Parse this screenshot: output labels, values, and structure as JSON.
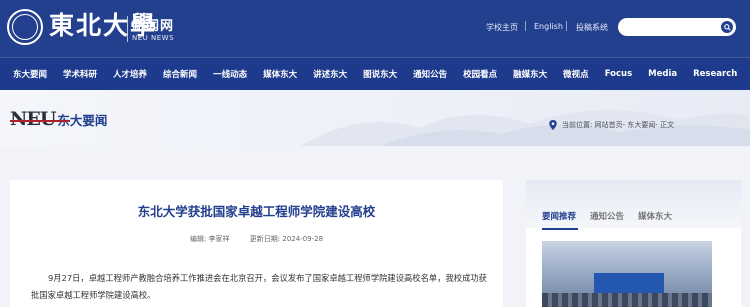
{
  "header": {
    "logo_calligraphy": "東北大學",
    "logo_news_cn": "新闻网",
    "logo_news_en": "NEU NEWS",
    "links": [
      "学校主页",
      "English",
      "投稿系统"
    ],
    "search_placeholder": ""
  },
  "nav": {
    "items": [
      "东大要闻",
      "学术科研",
      "人才培养",
      "综合新闻",
      "一线动态",
      "媒体东大",
      "讲述东大",
      "图说东大",
      "通知公告",
      "校园看点",
      "融媒东大",
      "微视点",
      "Focus",
      "Media",
      "Research"
    ]
  },
  "banner": {
    "neu": "NEU",
    "section_title": "东大要闻",
    "breadcrumb": "当前位置: 网站首页- 东大要闻- 正文"
  },
  "article": {
    "title": "东北大学获批国家卓越工程师学院建设高校",
    "editor": "编辑: 李家祥",
    "updated": "更新日期: 2024-09-28",
    "body": "9月27日，卓越工程师产教融合培养工作推进会在北京召开，会议发布了国家卓越工程师学院建设高校名单，我校成功获批国家卓越工程师学院建设高校。"
  },
  "sidebar": {
    "tabs": [
      "要闻推荐",
      "通知公告",
      "媒体东大"
    ]
  },
  "colors": {
    "primary": "#23408e",
    "nav": "#1d3a8c",
    "accent_red": "#b02028"
  }
}
